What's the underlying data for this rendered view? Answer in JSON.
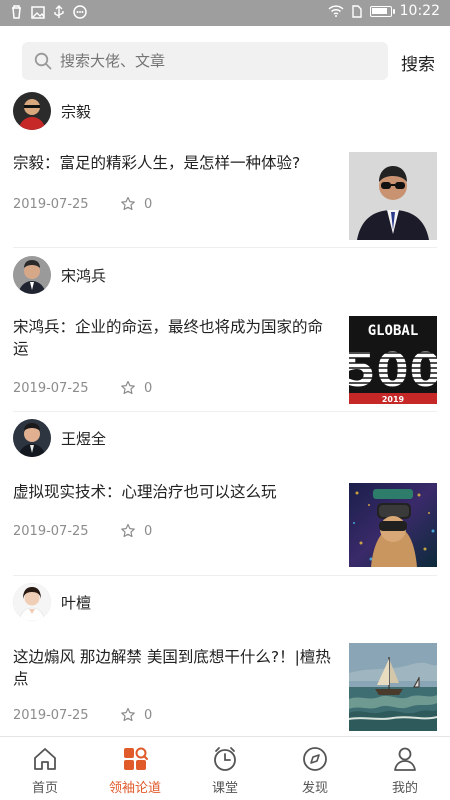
{
  "status_bar": {
    "time": "10:22",
    "battery_level": 0.9
  },
  "search": {
    "placeholder": "搜索大佬、文章",
    "button": "搜索"
  },
  "articles": [
    {
      "author": "宗毅",
      "title": "宗毅：富足的精彩人生，是怎样一种体验?",
      "date": "2019-07-25",
      "stars": "0"
    },
    {
      "author": "宋鸿兵",
      "title": "宋鸿兵：企业的命运，最终也将成为国家的命运",
      "date": "2019-07-25",
      "stars": "0",
      "thumb_text": {
        "line1": "GLOBAL",
        "line2": "500",
        "line3": "2019"
      }
    },
    {
      "author": "王煜全",
      "title": "虚拟现实技术：心理治疗也可以这么玩",
      "date": "2019-07-25",
      "stars": "0"
    },
    {
      "author": "叶檀",
      "title": "这边煽风  那边解禁  美国到底想干什么?！|檀热点",
      "date": "2019-07-25",
      "stars": "0"
    }
  ],
  "tabs": [
    {
      "label": "首页",
      "icon": "home-icon"
    },
    {
      "label": "领袖论道",
      "icon": "leaders-icon"
    },
    {
      "label": "课堂",
      "icon": "clock-icon"
    },
    {
      "label": "发现",
      "icon": "compass-icon"
    },
    {
      "label": "我的",
      "icon": "profile-icon"
    }
  ],
  "colors": {
    "accent": "#e05a2a",
    "statusbar": "#9e9e9e",
    "meta": "#8c8c8c"
  }
}
